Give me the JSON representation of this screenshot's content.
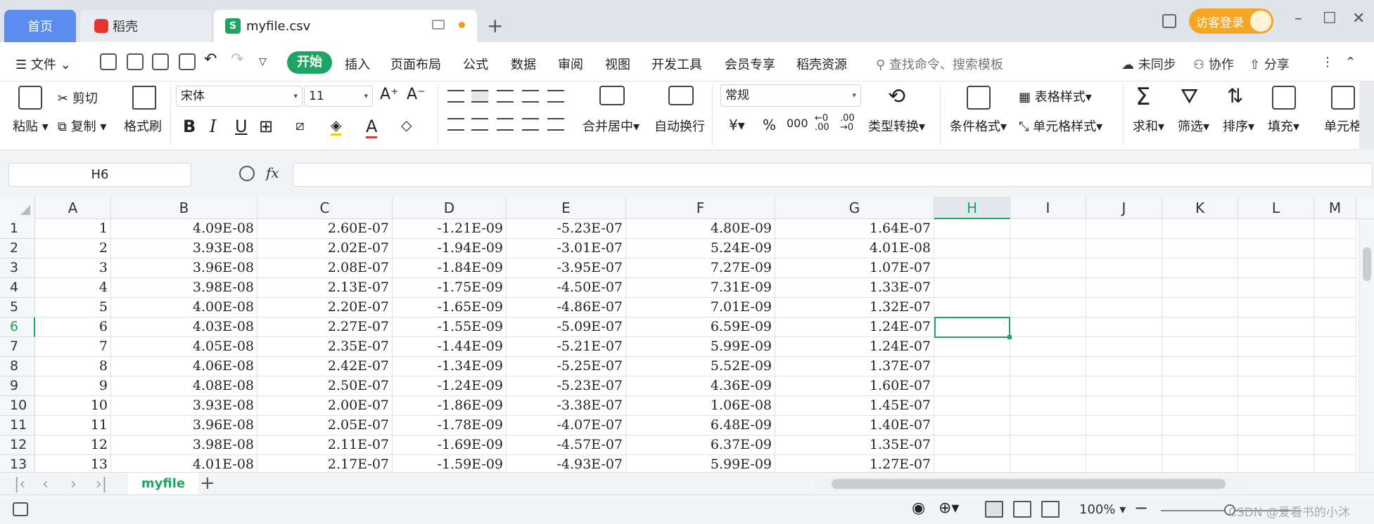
{
  "tabs": {
    "home": "首页",
    "daoke": "稻壳",
    "file": "myfile.csv",
    "file_icon": "S",
    "login": "访客登录"
  },
  "menu": {
    "file": "文件",
    "start": "开始",
    "items": [
      "插入",
      "页面布局",
      "公式",
      "数据",
      "审阅",
      "视图",
      "开发工具",
      "会员专享",
      "稻壳资源"
    ],
    "search": "查找命令、搜索模板",
    "unsync": "未同步",
    "collab": "协作",
    "share": "分享"
  },
  "ribbon": {
    "paste": "粘贴",
    "cut": "剪切",
    "copy": "复制",
    "format_painter": "格式刷",
    "font": "宋体",
    "font_size": "11",
    "merge_center": "合并居中",
    "wrap_text": "自动换行",
    "number_format": "常规",
    "type_convert": "类型转换",
    "cond_format": "条件格式",
    "table_style": "表格样式",
    "cell_style": "单元格样式",
    "sum": "求和",
    "filter": "筛选",
    "sort": "排序",
    "fill": "填充",
    "cell": "单元格",
    "bold": "B",
    "italic": "I",
    "underline": "U",
    "currency": "¥",
    "percent": "%",
    "thousands": "000"
  },
  "formula_bar": {
    "name_box": "H6",
    "fx": "fx",
    "formula": ""
  },
  "sheet": {
    "columns": [
      "A",
      "B",
      "C",
      "D",
      "E",
      "F",
      "G",
      "H",
      "I",
      "J",
      "K",
      "L",
      "M"
    ],
    "selected_column": "H",
    "selected_row": "6",
    "rows": [
      {
        "n": "1",
        "cells": [
          "1",
          "4.09E-08",
          "2.60E-07",
          "-1.21E-09",
          "-5.23E-07",
          "4.80E-09",
          "1.64E-07"
        ]
      },
      {
        "n": "2",
        "cells": [
          "2",
          "3.93E-08",
          "2.02E-07",
          "-1.94E-09",
          "-3.01E-07",
          "5.24E-09",
          "4.01E-08"
        ]
      },
      {
        "n": "3",
        "cells": [
          "3",
          "3.96E-08",
          "2.08E-07",
          "-1.84E-09",
          "-3.95E-07",
          "7.27E-09",
          "1.07E-07"
        ]
      },
      {
        "n": "4",
        "cells": [
          "4",
          "3.98E-08",
          "2.13E-07",
          "-1.75E-09",
          "-4.50E-07",
          "7.31E-09",
          "1.33E-07"
        ]
      },
      {
        "n": "5",
        "cells": [
          "5",
          "4.00E-08",
          "2.20E-07",
          "-1.65E-09",
          "-4.86E-07",
          "7.01E-09",
          "1.32E-07"
        ]
      },
      {
        "n": "6",
        "cells": [
          "6",
          "4.03E-08",
          "2.27E-07",
          "-1.55E-09",
          "-5.09E-07",
          "6.59E-09",
          "1.24E-07"
        ]
      },
      {
        "n": "7",
        "cells": [
          "7",
          "4.05E-08",
          "2.35E-07",
          "-1.44E-09",
          "-5.21E-07",
          "5.99E-09",
          "1.24E-07"
        ]
      },
      {
        "n": "8",
        "cells": [
          "8",
          "4.06E-08",
          "2.42E-07",
          "-1.34E-09",
          "-5.25E-07",
          "5.52E-09",
          "1.37E-07"
        ]
      },
      {
        "n": "9",
        "cells": [
          "9",
          "4.08E-08",
          "2.50E-07",
          "-1.24E-09",
          "-5.23E-07",
          "4.36E-09",
          "1.60E-07"
        ]
      },
      {
        "n": "10",
        "cells": [
          "10",
          "3.93E-08",
          "2.00E-07",
          "-1.86E-09",
          "-3.38E-07",
          "1.06E-08",
          "1.45E-07"
        ]
      },
      {
        "n": "11",
        "cells": [
          "11",
          "3.96E-08",
          "2.05E-07",
          "-1.78E-09",
          "-4.07E-07",
          "6.48E-09",
          "1.40E-07"
        ]
      },
      {
        "n": "12",
        "cells": [
          "12",
          "3.98E-08",
          "2.11E-07",
          "-1.69E-09",
          "-4.57E-07",
          "6.37E-09",
          "1.35E-07"
        ]
      },
      {
        "n": "13",
        "cells": [
          "13",
          "4.01E-08",
          "2.17E-07",
          "-1.59E-09",
          "-4.93E-07",
          "5.99E-09",
          "1.27E-07"
        ]
      }
    ],
    "tab_name": "myfile"
  },
  "status": {
    "zoom": "100%",
    "watermark": "CSDN @爱看书的小沐"
  },
  "colors": {
    "accent_green": "#1fa463",
    "home_tab_blue": "#5b8def",
    "login_orange": "#f6a623",
    "unsaved_dot": "#f59b16"
  }
}
